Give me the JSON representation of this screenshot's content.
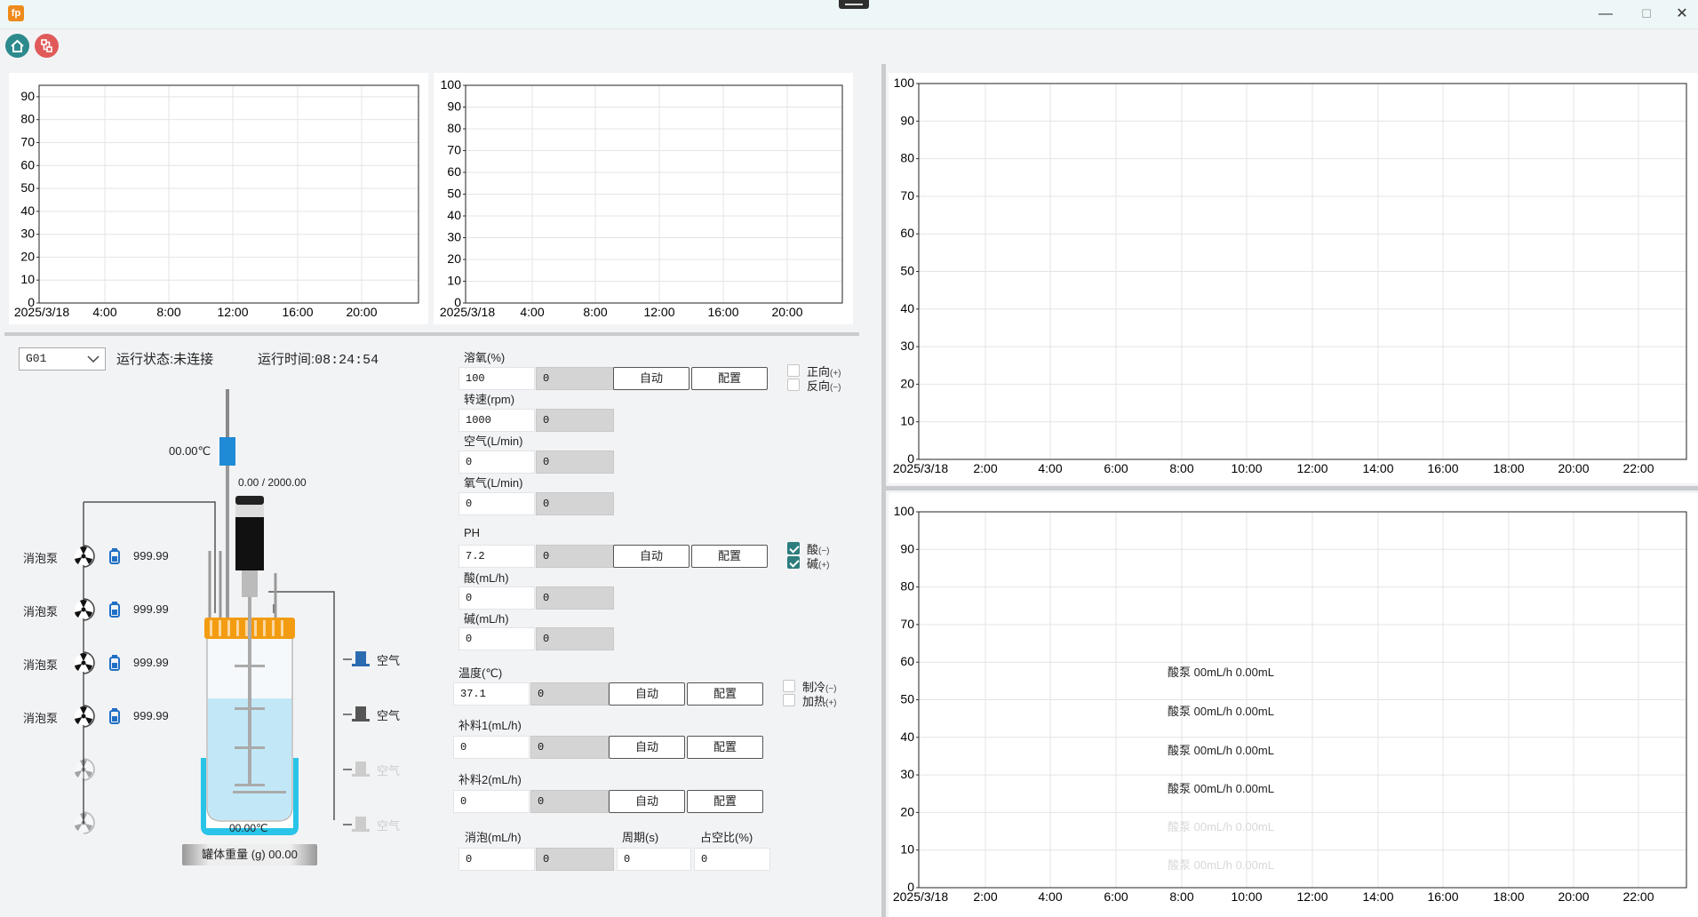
{
  "window": {
    "app_icon_text": "fp",
    "minimize": "—",
    "maximize": "☐",
    "close": "✕"
  },
  "toolbar": {
    "home_icon": "home-icon",
    "share_icon": "network-icon"
  },
  "charts": {
    "top_left": {
      "y_ticks": [
        "0",
        "10",
        "20",
        "30",
        "40",
        "50",
        "60",
        "70",
        "80",
        "90"
      ],
      "x_ticks": [
        "2025/3/18",
        "4:00",
        "8:00",
        "12:00",
        "16:00",
        "20:00"
      ]
    },
    "top_mid": {
      "y_ticks": [
        "0",
        "10",
        "20",
        "30",
        "40",
        "50",
        "60",
        "70",
        "80",
        "90",
        "100"
      ],
      "x_ticks": [
        "2025/3/18",
        "4:00",
        "8:00",
        "12:00",
        "16:00",
        "20:00"
      ]
    },
    "right_top": {
      "y_ticks": [
        "0",
        "10",
        "20",
        "30",
        "40",
        "50",
        "60",
        "70",
        "80",
        "90",
        "100"
      ],
      "x_ticks": [
        "2025/3/18",
        "2:00",
        "4:00",
        "6:00",
        "8:00",
        "10:00",
        "12:00",
        "14:00",
        "16:00",
        "18:00",
        "20:00",
        "22:00"
      ]
    },
    "right_bottom": {
      "y_ticks": [
        "0",
        "10",
        "20",
        "30",
        "40",
        "50",
        "60",
        "70",
        "80",
        "90",
        "100"
      ],
      "x_ticks": [
        "2025/3/18",
        "2:00",
        "4:00",
        "6:00",
        "8:00",
        "10:00",
        "12:00",
        "14:00",
        "16:00",
        "18:00",
        "20:00",
        "22:00"
      ]
    }
  },
  "chart_data": [
    {
      "type": "line",
      "title": "",
      "xlabel": "",
      "ylabel": "",
      "ylim": [
        0,
        95
      ],
      "x_categories": [
        "2025/3/18",
        "4:00",
        "8:00",
        "12:00",
        "16:00",
        "20:00"
      ],
      "series": [],
      "grid": true
    },
    {
      "type": "line",
      "title": "",
      "xlabel": "",
      "ylabel": "",
      "ylim": [
        0,
        100
      ],
      "x_categories": [
        "2025/3/18",
        "4:00",
        "8:00",
        "12:00",
        "16:00",
        "20:00"
      ],
      "series": [],
      "grid": true
    },
    {
      "type": "line",
      "title": "",
      "xlabel": "",
      "ylabel": "",
      "ylim": [
        0,
        100
      ],
      "x_categories": [
        "2025/3/18",
        "2:00",
        "4:00",
        "6:00",
        "8:00",
        "10:00",
        "12:00",
        "14:00",
        "16:00",
        "18:00",
        "20:00",
        "22:00"
      ],
      "series": [],
      "grid": true
    },
    {
      "type": "line",
      "title": "",
      "xlabel": "",
      "ylabel": "",
      "ylim": [
        0,
        100
      ],
      "x_categories": [
        "2025/3/18",
        "2:00",
        "4:00",
        "6:00",
        "8:00",
        "10:00",
        "12:00",
        "14:00",
        "16:00",
        "18:00",
        "20:00",
        "22:00"
      ],
      "series": [],
      "grid": true
    }
  ],
  "status": {
    "device": "G01",
    "state_label": "运行状态:",
    "state_value": "未连接",
    "time_label": "运行时间:",
    "time_value": "08:24:54"
  },
  "reactor": {
    "probe_temp": "00.00℃",
    "motor_value": "0.00 / 2000.00",
    "jacket_temp": "00.00℃",
    "weight_label": "罐体重量 (g)",
    "weight_value": "00.00",
    "pumps": [
      {
        "name": "消泡泵",
        "value": "999.99",
        "active": true
      },
      {
        "name": "消泡泵",
        "value": "999.99",
        "active": true
      },
      {
        "name": "消泡泵",
        "value": "999.99",
        "active": true
      },
      {
        "name": "消泡泵",
        "value": "999.99",
        "active": true
      },
      {
        "name": "",
        "value": "",
        "active": false
      },
      {
        "name": "",
        "value": "",
        "active": false
      }
    ],
    "gases": [
      {
        "name": "空气",
        "active": true,
        "color": "#2b6cb0"
      },
      {
        "name": "空气",
        "active": true,
        "color": "#555555"
      },
      {
        "name": "空气",
        "active": false,
        "color": "#cccccc"
      },
      {
        "name": "空气",
        "active": false,
        "color": "#cccccc"
      }
    ]
  },
  "controls": {
    "do": {
      "label": "溶氧(%)",
      "set": "100",
      "read": "0",
      "auto": "自动",
      "config": "配置"
    },
    "speed": {
      "label": "转速(rpm)",
      "set": "1000",
      "read": "0"
    },
    "air": {
      "label": "空气(L/min)",
      "set": "0",
      "read": "0"
    },
    "oxygen": {
      "label": "氧气(L/min)",
      "set": "0",
      "read": "0"
    },
    "direction": {
      "forward": "正向",
      "forward_sign": "(+)",
      "reverse": "反向",
      "reverse_sign": "(−)",
      "forward_checked": false,
      "reverse_checked": false
    },
    "ph": {
      "label": "PH",
      "set": "7.2",
      "read": "0",
      "auto": "自动",
      "config": "配置"
    },
    "acid": {
      "label": "酸(mL/h)",
      "set": "0",
      "read": "0"
    },
    "base": {
      "label": "碱(mL/h)",
      "set": "0",
      "read": "0"
    },
    "acidbase": {
      "acid": "酸",
      "acid_sign": "(−)",
      "base": "碱",
      "base_sign": "(+)",
      "acid_checked": true,
      "base_checked": true
    },
    "temp": {
      "label": "温度(℃)",
      "set": "37.1",
      "read": "0",
      "auto": "自动",
      "config": "配置"
    },
    "coolheat": {
      "cool": "制冷",
      "cool_sign": "(−)",
      "heat": "加热",
      "heat_sign": "(+)",
      "cool_checked": false,
      "heat_checked": false
    },
    "feed1": {
      "label": "补料1(mL/h)",
      "set": "0",
      "read": "0",
      "auto": "自动",
      "config": "配置"
    },
    "feed2": {
      "label": "补料2(mL/h)",
      "set": "0",
      "read": "0",
      "auto": "自动",
      "config": "配置"
    },
    "antifoam": {
      "label": "消泡(mL/h)",
      "set": "0",
      "read": "0",
      "period_label": "周期(s)",
      "period": "0",
      "duty_label": "占空比(%)",
      "duty": "0"
    }
  },
  "acid_pump_list": [
    {
      "text": "酸泵 00mL/h  0.00mL",
      "active": true
    },
    {
      "text": "酸泵 00mL/h  0.00mL",
      "active": true
    },
    {
      "text": "酸泵 00mL/h  0.00mL",
      "active": true
    },
    {
      "text": "酸泵 00mL/h  0.00mL",
      "active": true
    },
    {
      "text": "酸泵 00mL/h  0.00mL",
      "active": false
    },
    {
      "text": "酸泵 00mL/h  0.00mL",
      "active": false
    }
  ]
}
